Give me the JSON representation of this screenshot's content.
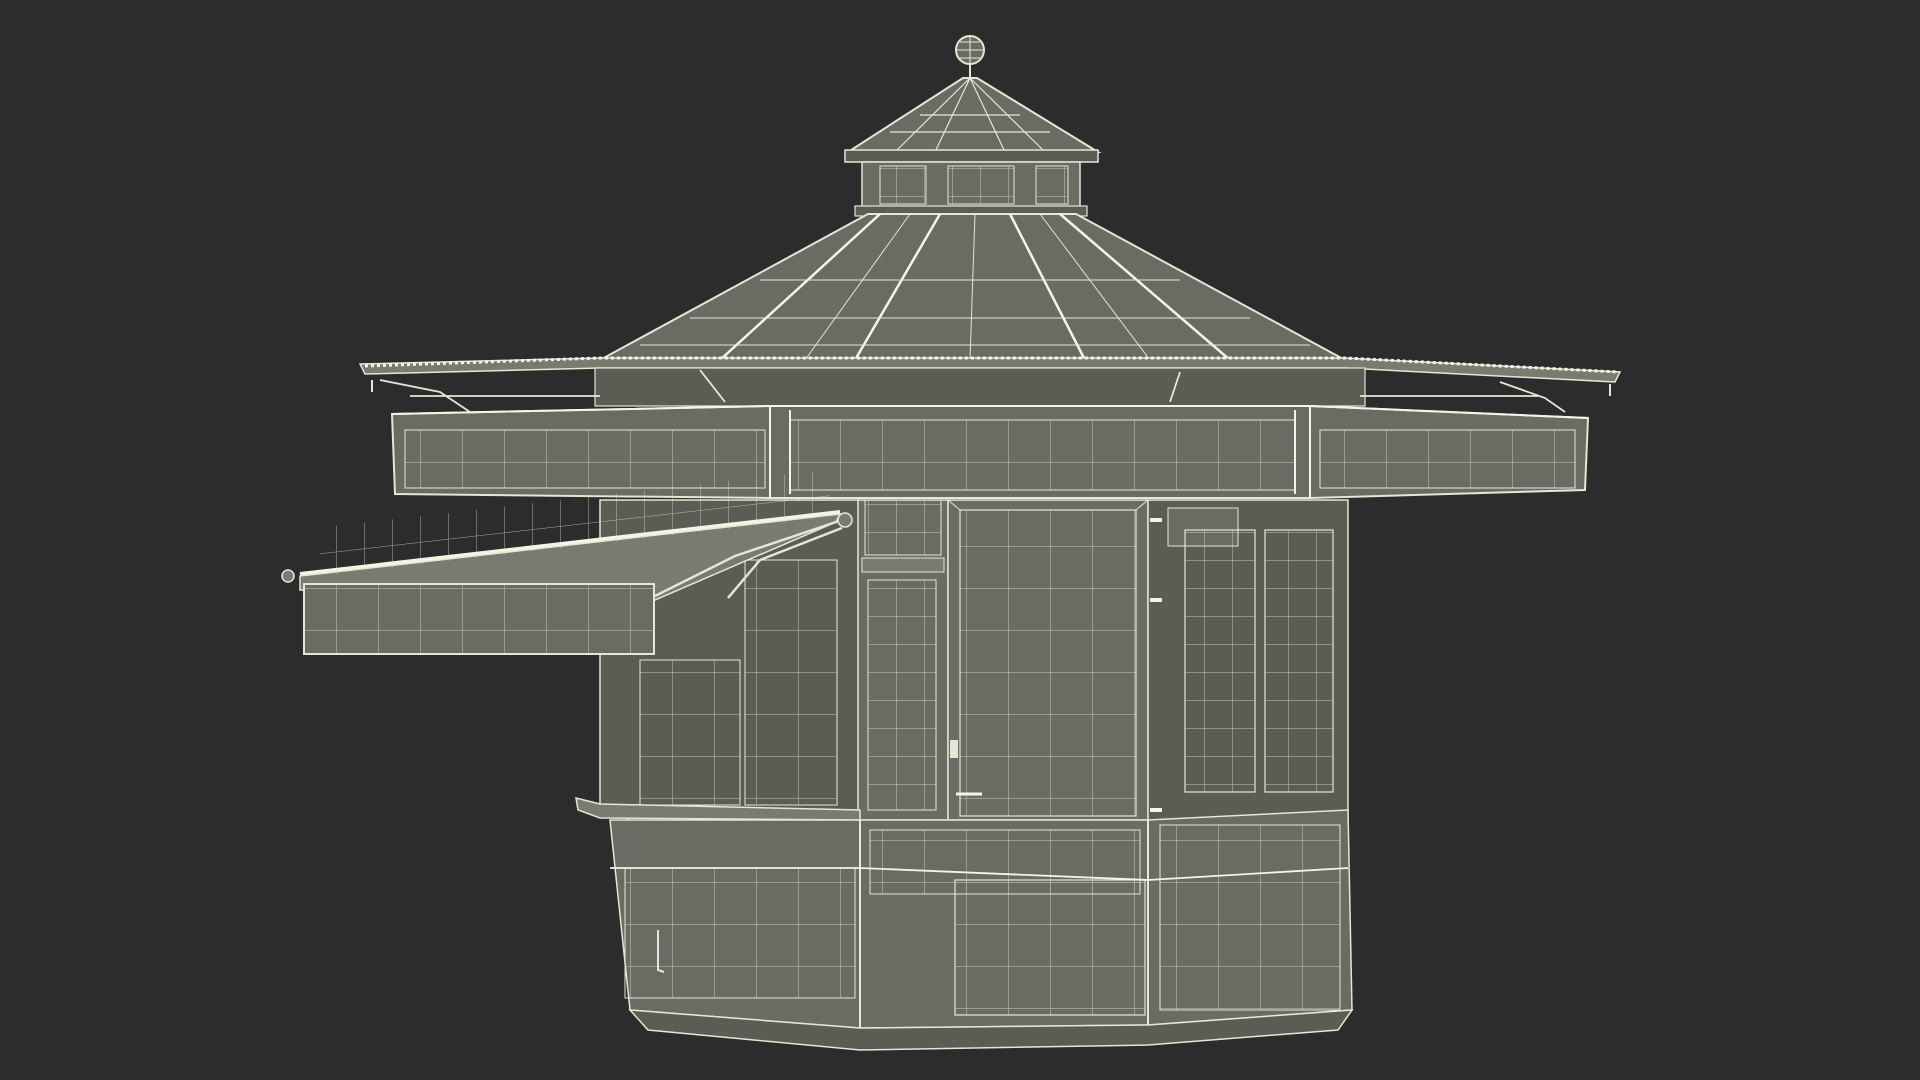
{
  "scene": {
    "subject": "wireframe-octagonal-kiosk",
    "colors": {
      "background": "#2c2c2c",
      "surface": "#6b6b63",
      "surface_dark": "#5c5c55",
      "surface_light": "#7a7a71",
      "wire": "#e6e6d4",
      "wire_strong": "#f5f5e6"
    }
  }
}
